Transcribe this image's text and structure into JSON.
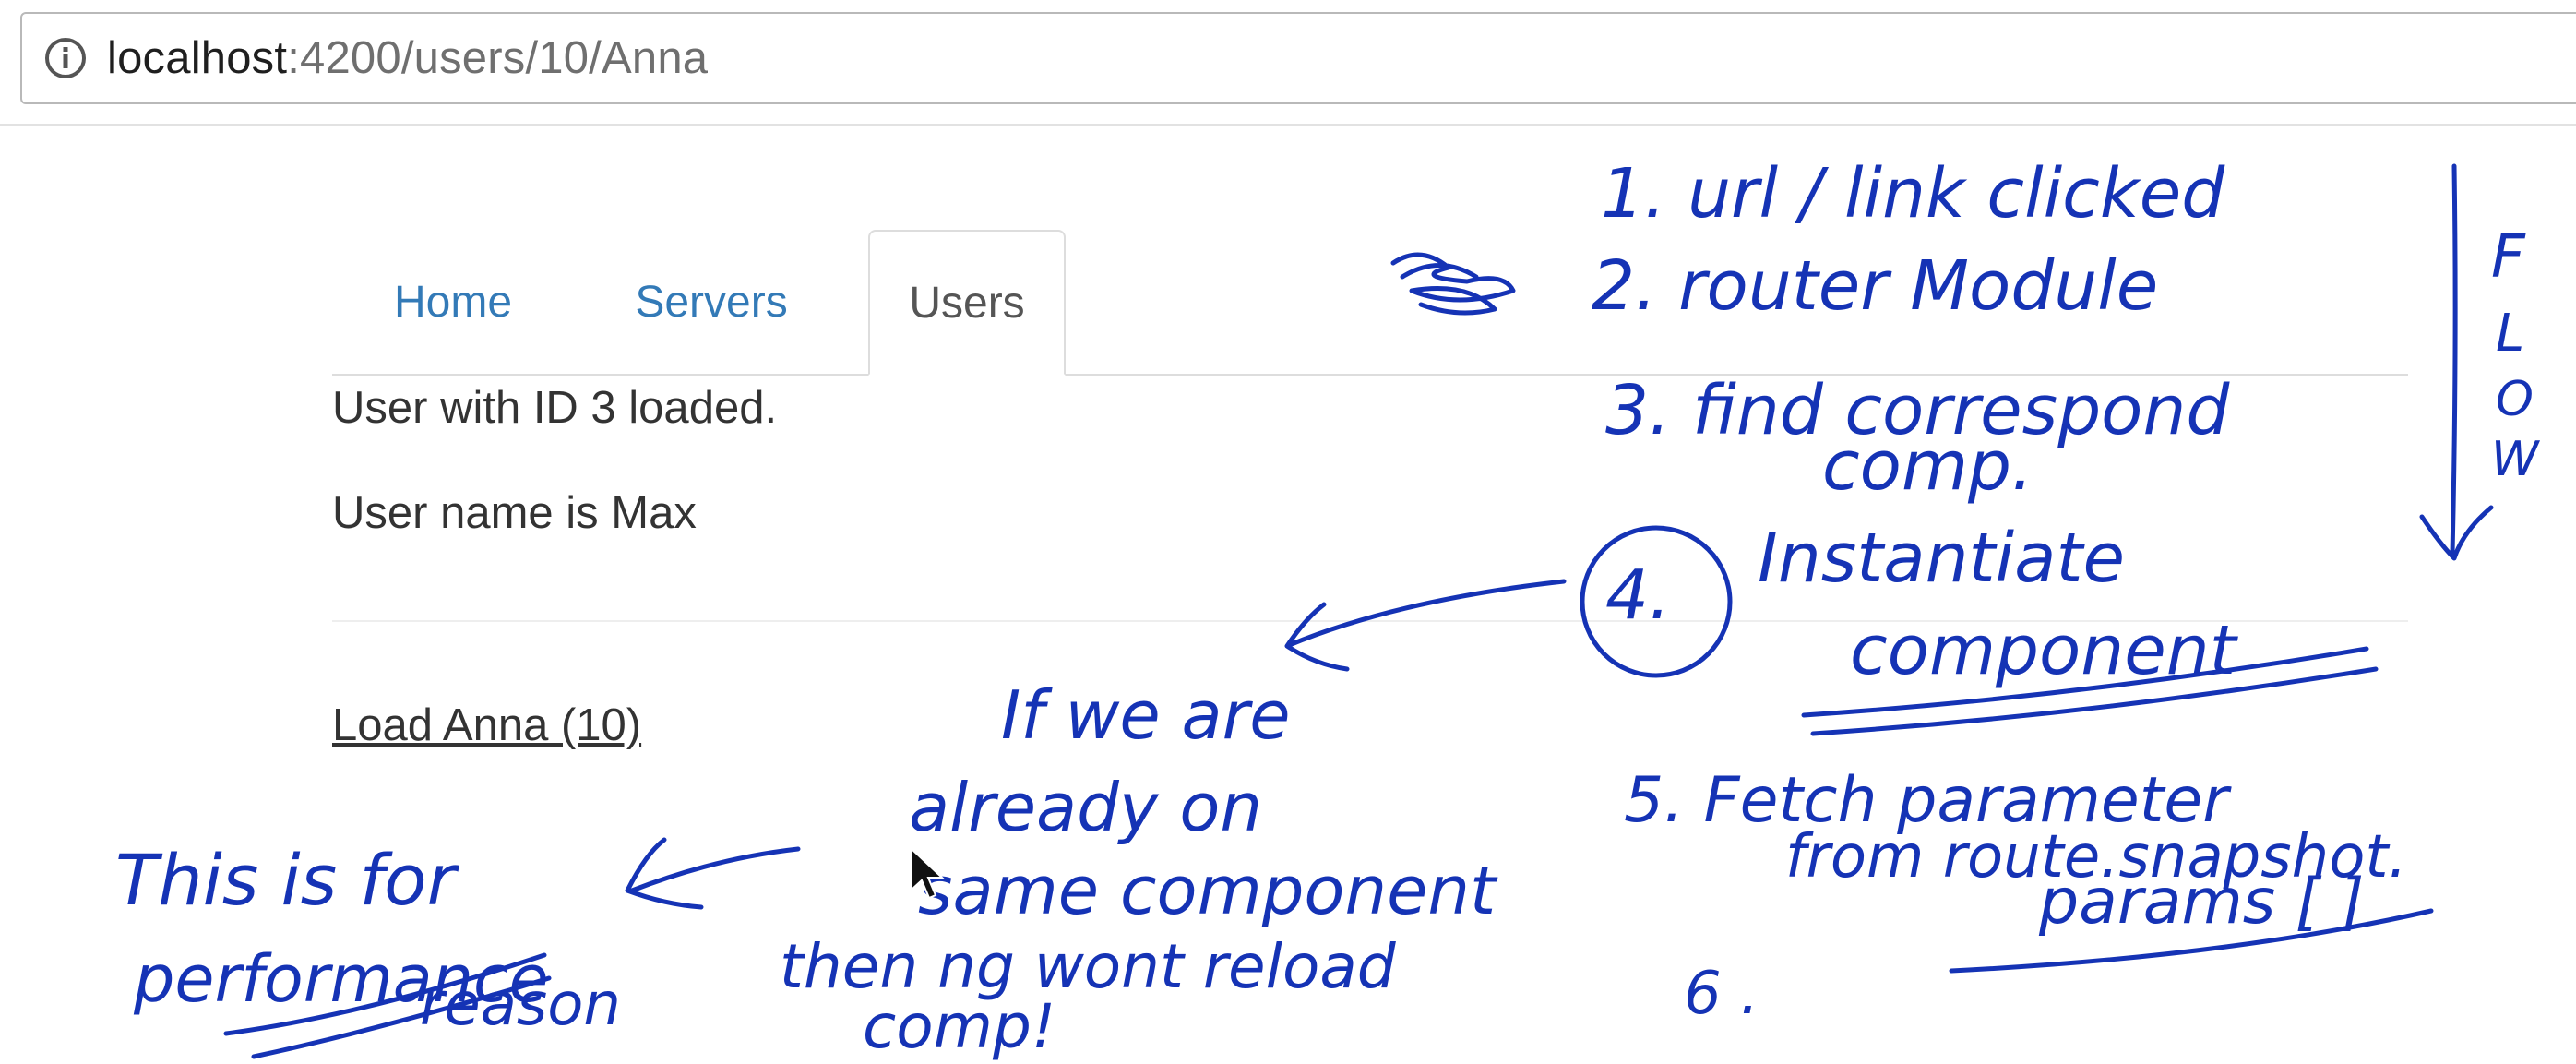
{
  "browser": {
    "url_host": "localhost",
    "url_path": ":4200/users/10/Anna",
    "icon": "info-icon"
  },
  "nav": {
    "tabs": [
      {
        "label": "Home",
        "active": false
      },
      {
        "label": "Servers",
        "active": false
      },
      {
        "label": "Users",
        "active": true
      }
    ]
  },
  "user": {
    "loaded_text": "User with ID 3 loaded.",
    "name_text": "User name is Max",
    "load_link": "Load Anna (10)"
  },
  "annotations": {
    "flow_steps": [
      "1. url / link clicked",
      "2. router Module",
      "3. find correspond",
      "comp.",
      "4.",
      "Instantiate",
      "component",
      "5. Fetch parameter",
      "from route.snapshot.",
      "params [ ]",
      "6 ."
    ],
    "flow_label": [
      "F",
      "L",
      "O",
      "W"
    ],
    "note_middle": [
      "If we are",
      "already on",
      "same component",
      "then ng wont reload",
      "comp!"
    ],
    "note_left": [
      "This is for",
      "performance",
      "reason"
    ]
  },
  "colors": {
    "ink": "#1533b5",
    "link": "#337ab7",
    "text": "#333333"
  }
}
